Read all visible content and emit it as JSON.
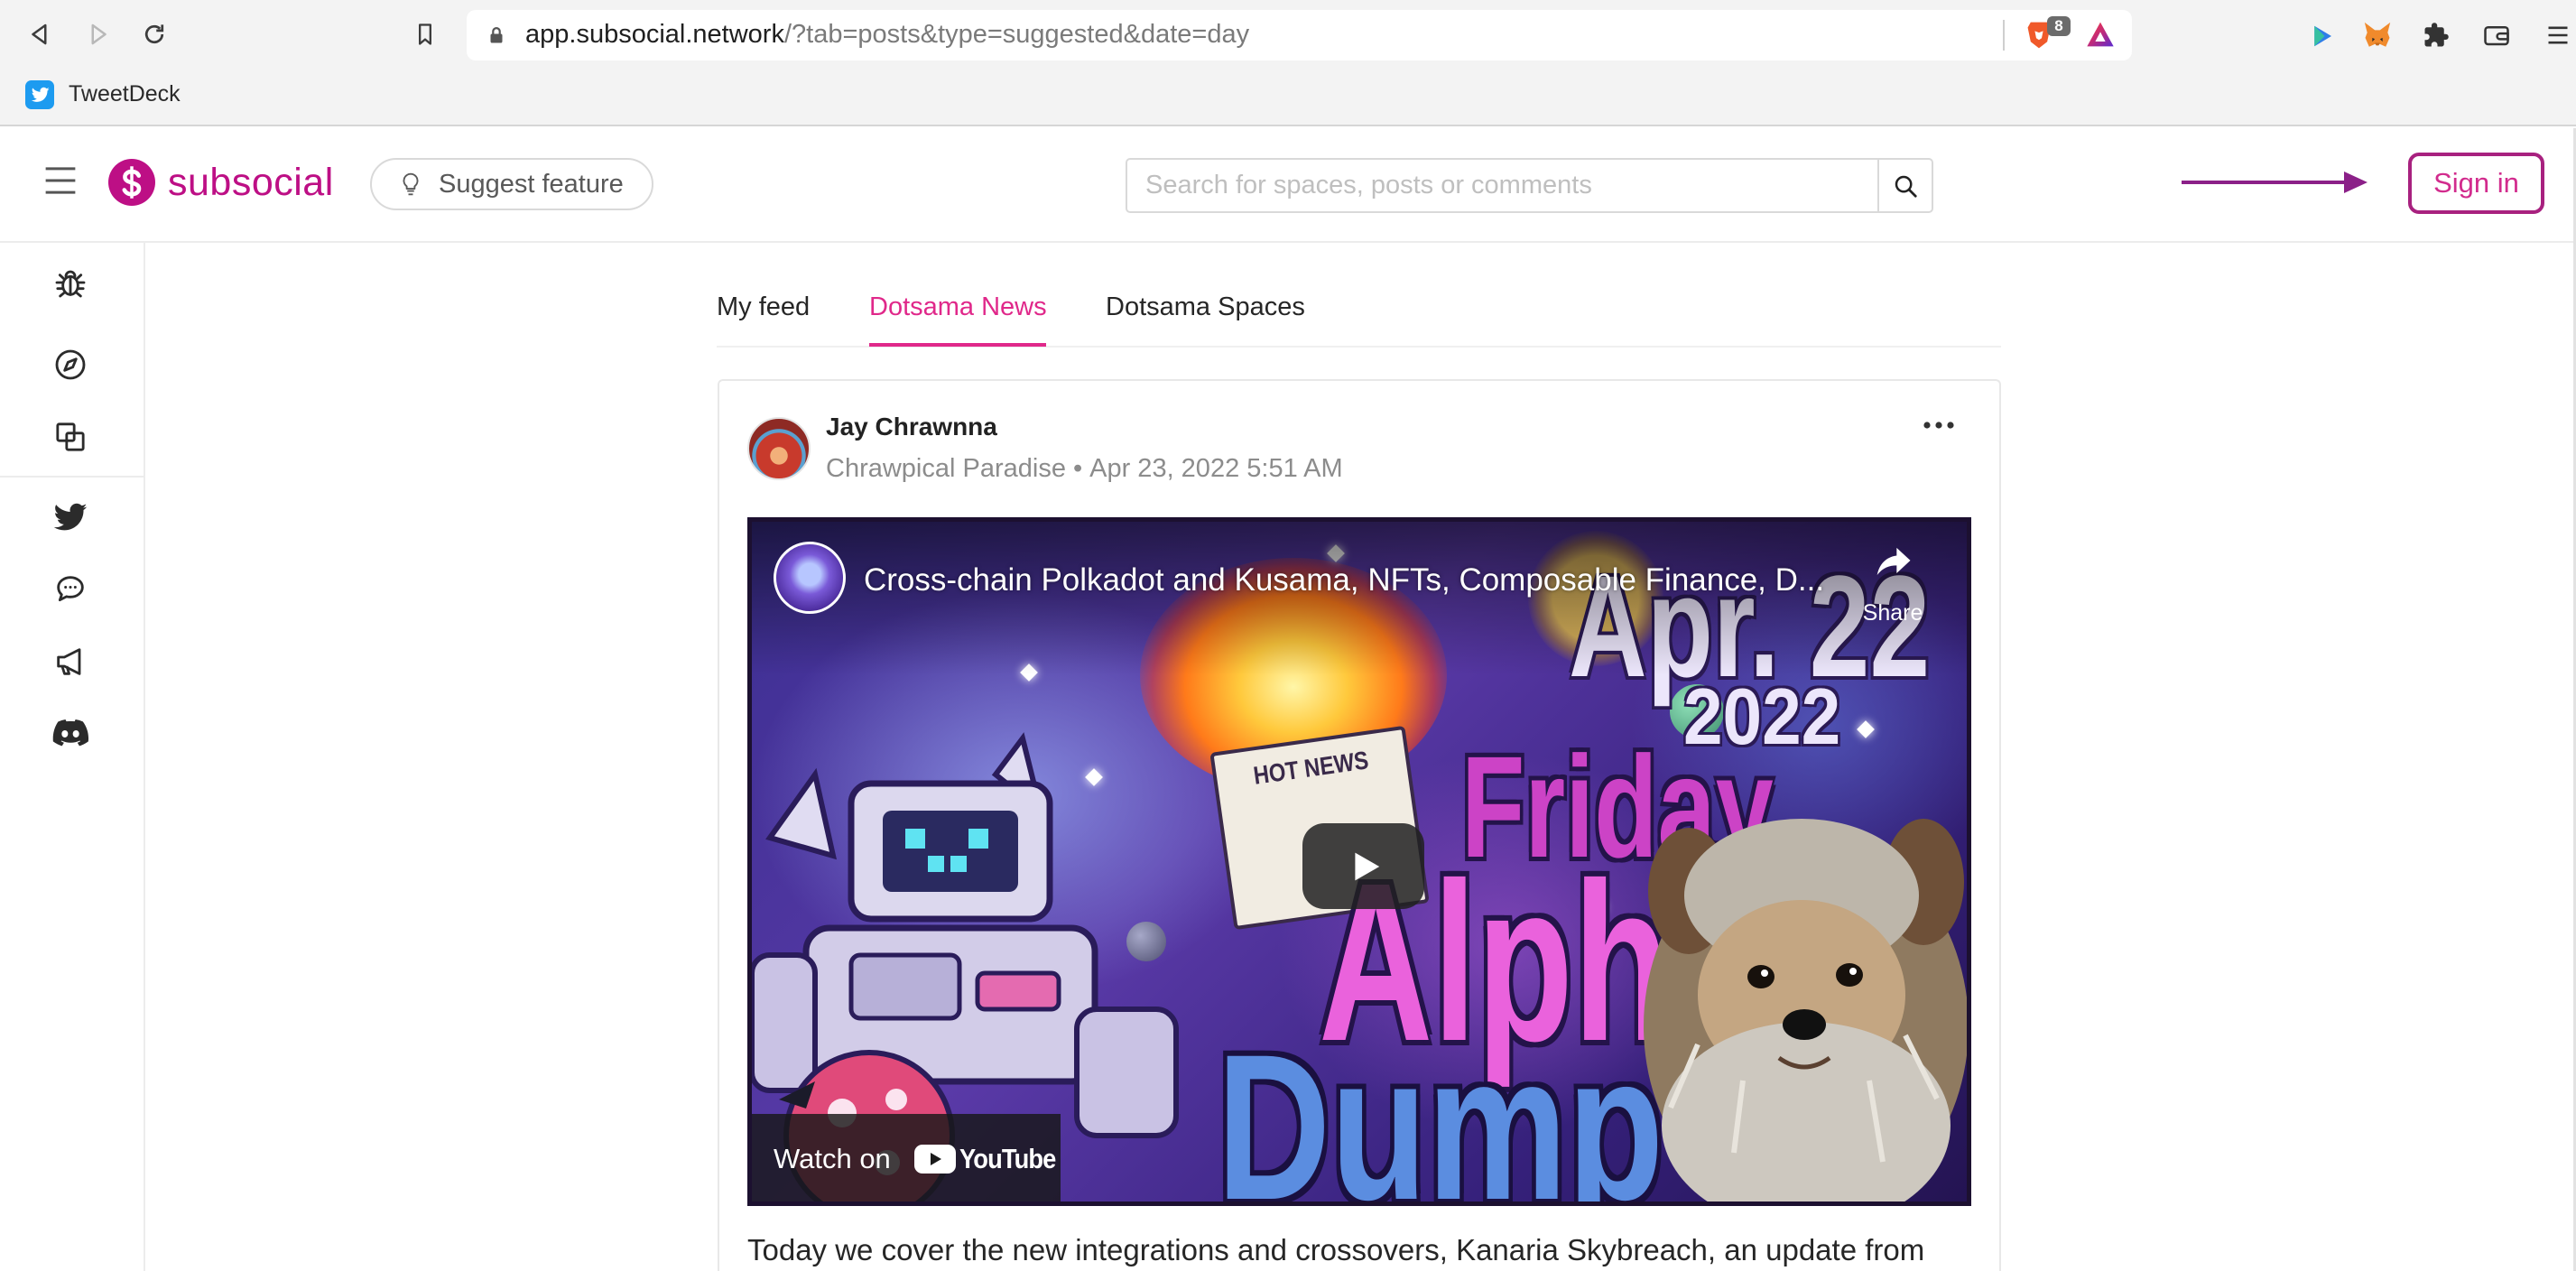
{
  "browser": {
    "url_host": "app.subsocial.network",
    "url_path": "/?tab=posts&type=suggested&date=day",
    "shields_badge": "8",
    "bookmarks": [
      {
        "label": "TweetDeck",
        "icon": "tweetdeck-icon"
      }
    ],
    "toolbar_icons": [
      "back-icon",
      "forward-icon",
      "reload-icon",
      "bookmark-icon",
      "lock-icon",
      "brave-shields-icon",
      "brave-rewards-icon",
      "play-extension-icon",
      "metamask-fox-icon",
      "extensions-puzzle-icon",
      "wallet-icon",
      "menu-icon"
    ]
  },
  "header": {
    "logo_text": "subsocial",
    "suggest_label": "Suggest feature",
    "search_placeholder": "Search for spaces, posts or comments",
    "sign_in_label": "Sign in"
  },
  "sidebar": {
    "items": [
      {
        "icon": "bug-icon"
      },
      {
        "icon": "compass-icon"
      },
      {
        "icon": "overlap-squares-icon"
      },
      {
        "icon": "twitter-icon"
      },
      {
        "icon": "chat-icon"
      },
      {
        "icon": "megaphone-icon"
      },
      {
        "icon": "discord-icon"
      }
    ]
  },
  "tabs": [
    {
      "label": "My feed",
      "active": false
    },
    {
      "label": "Dotsama News",
      "active": true
    },
    {
      "label": "Dotsama Spaces",
      "active": false
    }
  ],
  "post": {
    "author": "Jay Chrawnna",
    "space": "Chrawpical Paradise",
    "separator": "•",
    "date": "Apr 23, 2022 5:51 AM",
    "video": {
      "title": "Cross-chain Polkadot and Kusama, NFTs, Composable Finance, D...",
      "share_label": "Share",
      "watch_on": "Watch on",
      "youtube": "YouTube",
      "thumbnail_text": {
        "date": "Apr. 22",
        "year": "2022",
        "hot_news": "HOT NEWS",
        "friday": "Friday",
        "alph": "Alph",
        "dump": "Dump"
      }
    },
    "body": "Today we cover the new integrations and crossovers, Kanaria Skybreach, an update from"
  },
  "colors": {
    "accent": "#e0288a",
    "logo": "#bd0f85",
    "sign_in_border": "#a8217f",
    "arrow": "#8b2088",
    "muted_text": "#8c8c8c"
  }
}
